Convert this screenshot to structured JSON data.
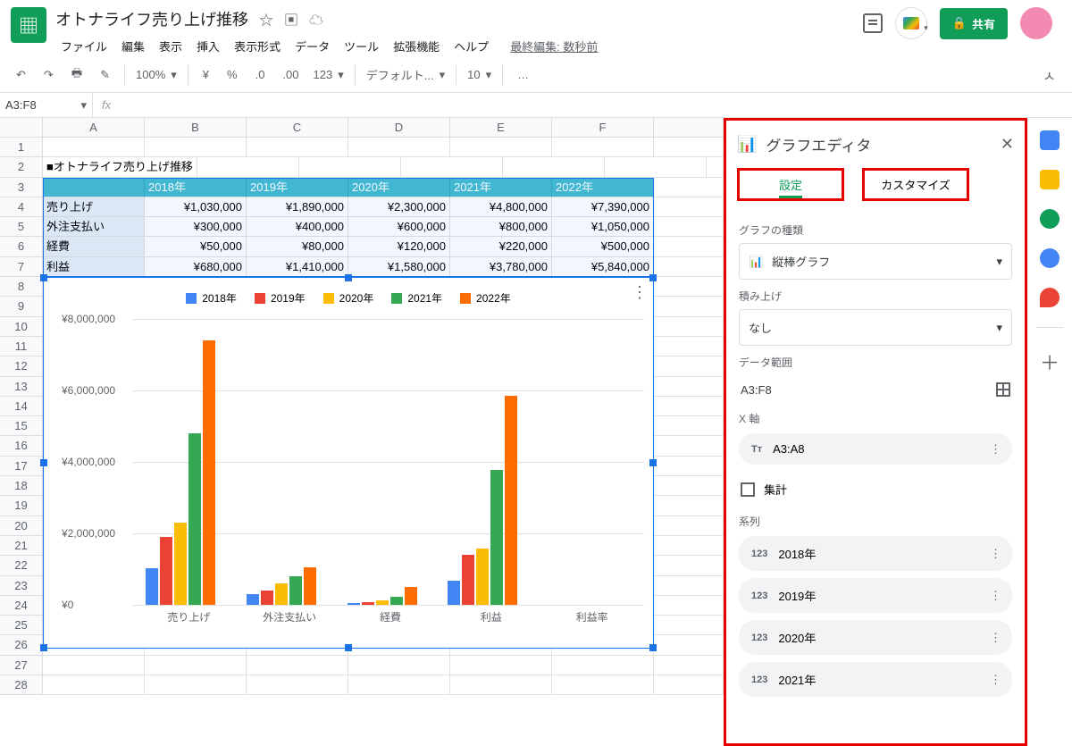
{
  "doc": {
    "title": "オトナライフ売り上げ推移"
  },
  "menus": [
    "ファイル",
    "編集",
    "表示",
    "挿入",
    "表示形式",
    "データ",
    "ツール",
    "拡張機能",
    "ヘルプ"
  ],
  "last_edit": "最終編集: 数秒前",
  "share_label": "共有",
  "toolbar": {
    "zoom": "100%",
    "currency": "¥",
    "pct": "%",
    "dec0": ".0",
    "dec00": ".00",
    "fmt": "123",
    "font": "デフォルト...",
    "size": "10",
    "more": "…"
  },
  "namebox": "A3:F8",
  "columns": [
    "A",
    "B",
    "C",
    "D",
    "E",
    "F"
  ],
  "rows": 28,
  "sheet": {
    "title_cell": "■オトナライフ売り上げ推移",
    "years": [
      "2018年",
      "2019年",
      "2020年",
      "2021年",
      "2022年"
    ],
    "categories": [
      "売り上げ",
      "外注支払い",
      "経費",
      "利益"
    ],
    "values": {
      "売り上げ": [
        "¥1,030,000",
        "¥1,890,000",
        "¥2,300,000",
        "¥4,800,000",
        "¥7,390,000"
      ],
      "外注支払い": [
        "¥300,000",
        "¥400,000",
        "¥600,000",
        "¥800,000",
        "¥1,050,000"
      ],
      "経費": [
        "¥50,000",
        "¥80,000",
        "¥120,000",
        "¥220,000",
        "¥500,000"
      ],
      "利益": [
        "¥680,000",
        "¥1,410,000",
        "¥1,580,000",
        "¥3,780,000",
        "¥5,840,000"
      ]
    }
  },
  "chart_data": {
    "type": "bar",
    "categories": [
      "売り上げ",
      "外注支払い",
      "経費",
      "利益",
      "利益率"
    ],
    "series": [
      {
        "name": "2018年",
        "color": "#4285f4",
        "values": [
          1030000,
          300000,
          50000,
          680000,
          null
        ]
      },
      {
        "name": "2019年",
        "color": "#ea4335",
        "values": [
          1890000,
          400000,
          80000,
          1410000,
          null
        ]
      },
      {
        "name": "2020年",
        "color": "#fbbc04",
        "values": [
          2300000,
          600000,
          120000,
          1580000,
          null
        ]
      },
      {
        "name": "2021年",
        "color": "#34a853",
        "values": [
          4800000,
          800000,
          220000,
          3780000,
          null
        ]
      },
      {
        "name": "2022年",
        "color": "#ff6d01",
        "values": [
          7390000,
          1050000,
          500000,
          5840000,
          null
        ]
      }
    ],
    "ylabel": "",
    "yticks": [
      "¥0",
      "¥2,000,000",
      "¥4,000,000",
      "¥6,000,000",
      "¥8,000,000"
    ],
    "ylim": [
      0,
      8000000
    ]
  },
  "editor": {
    "title": "グラフエディタ",
    "tab_setup": "設定",
    "tab_customize": "カスタマイズ",
    "chart_type_label": "グラフの種類",
    "chart_type_value": "縦棒グラフ",
    "stack_label": "積み上げ",
    "stack_value": "なし",
    "range_label": "データ範囲",
    "range_value": "A3:F8",
    "xaxis_label": "X 軸",
    "xaxis_value": "A3:A8",
    "aggregate": "集計",
    "series_label": "系列",
    "series": [
      "2018年",
      "2019年",
      "2020年",
      "2021年"
    ]
  }
}
